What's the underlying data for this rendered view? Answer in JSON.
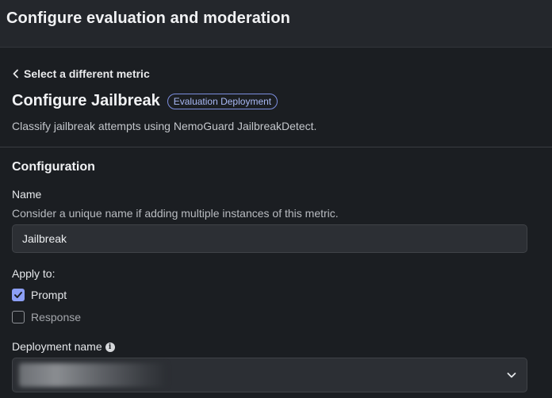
{
  "header": {
    "title": "Configure evaluation and moderation"
  },
  "back_link": {
    "label": "Select a different metric"
  },
  "page": {
    "title": "Configure Jailbreak",
    "badge": "Evaluation Deployment",
    "subtitle": "Classify jailbreak attempts using NemoGuard JailbreakDetect."
  },
  "configuration": {
    "section_title": "Configuration",
    "name": {
      "label": "Name",
      "helper": "Consider a unique name if adding multiple instances of this metric.",
      "value": "Jailbreak"
    },
    "apply_to": {
      "label": "Apply to:",
      "options": [
        {
          "label": "Prompt",
          "checked": true
        },
        {
          "label": "Response",
          "checked": false
        }
      ]
    },
    "deployment": {
      "label": "Deployment name",
      "info_icon": "info-icon",
      "value": "",
      "chevron_icon": "chevron-down-icon"
    }
  },
  "colors": {
    "background": "#1b1e22",
    "header": "#24272c",
    "accent": "#8c9ff5",
    "badge_border": "#7d8fe0",
    "input_bg": "#2c2f34"
  }
}
